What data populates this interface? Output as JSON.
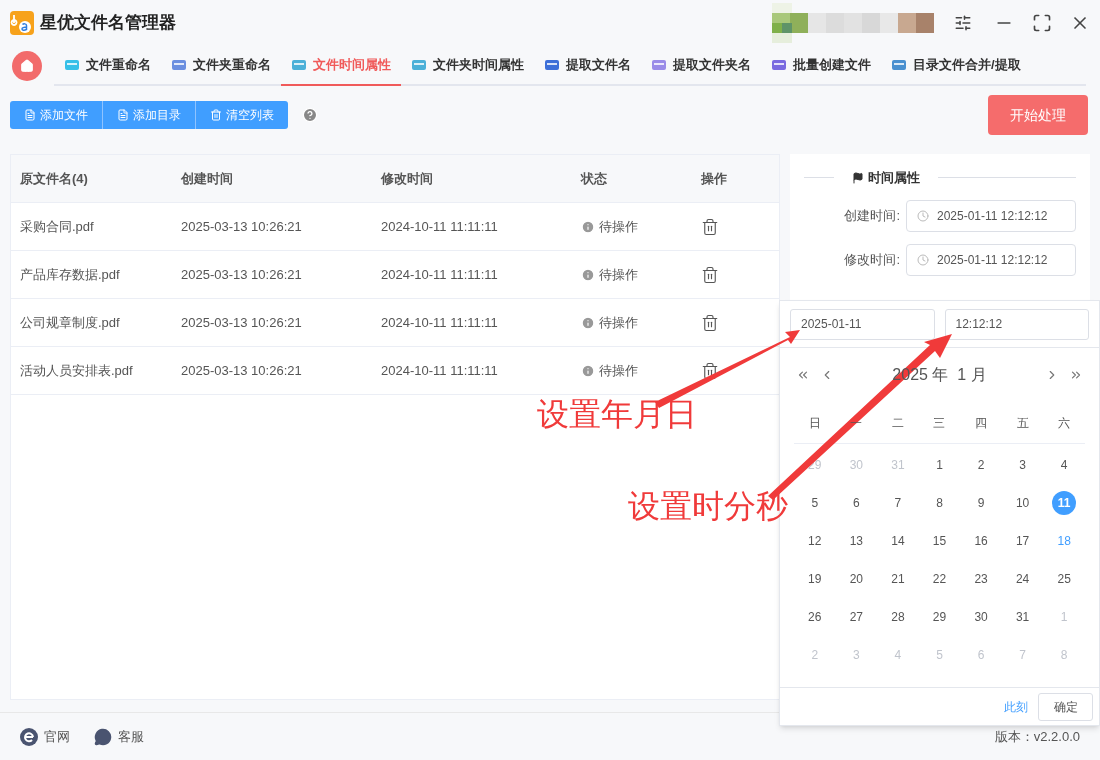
{
  "window": {
    "title": "星优文件名管理器"
  },
  "tabs": [
    {
      "label": "文件重命名",
      "selected": false,
      "color": "#36c0e8"
    },
    {
      "label": "文件夹重命名",
      "selected": false,
      "color": "#6b8fe0"
    },
    {
      "label": "文件时间属性",
      "selected": true,
      "color": "#4bb0d8"
    },
    {
      "label": "文件夹时间属性",
      "selected": false,
      "color": "#4bb0d8"
    },
    {
      "label": "提取文件名",
      "selected": false,
      "color": "#3d6fd8"
    },
    {
      "label": "提取文件夹名",
      "selected": false,
      "color": "#9a8ce8"
    },
    {
      "label": "批量创建文件",
      "selected": false,
      "color": "#7a6ae0"
    },
    {
      "label": "目录文件合并/提取",
      "selected": false,
      "color": "#4a90d0"
    }
  ],
  "toolbar": {
    "buttons": [
      {
        "label": "添加文件",
        "kind": "file"
      },
      {
        "label": "添加目录",
        "kind": "file"
      },
      {
        "label": "清空列表",
        "kind": "trash"
      }
    ],
    "start_button": "开始处理"
  },
  "table": {
    "columns": [
      "原文件名(4)",
      "创建时间",
      "修改时间",
      "状态",
      "操作"
    ],
    "rows": [
      {
        "name": "采购合同.pdf",
        "created": "2025-03-13 10:26:21",
        "modified": "2024-10-11 11:11:11",
        "status": "待操作"
      },
      {
        "name": "产品库存数据.pdf",
        "created": "2025-03-13 10:26:21",
        "modified": "2024-10-11 11:11:11",
        "status": "待操作"
      },
      {
        "name": "公司规章制度.pdf",
        "created": "2025-03-13 10:26:21",
        "modified": "2024-10-11 11:11:11",
        "status": "待操作"
      },
      {
        "name": "活动人员安排表.pdf",
        "created": "2025-03-13 10:26:21",
        "modified": "2024-10-11 11:11:11",
        "status": "待操作"
      }
    ]
  },
  "panel": {
    "title": "时间属性",
    "fields": [
      {
        "label": "创建时间:",
        "value": "2025-01-11 12:12:12"
      },
      {
        "label": "修改时间:",
        "value": "2025-01-11 12:12:12"
      }
    ]
  },
  "date_picker": {
    "date_value": "2025-01-11",
    "time_value": "12:12:12",
    "month_label": "2025 年  1 月",
    "weekdays": [
      "日",
      "一",
      "二",
      "三",
      "四",
      "五",
      "六"
    ],
    "days": [
      {
        "label": "29",
        "outside": true,
        "selected": false,
        "today": false
      },
      {
        "label": "30",
        "outside": true,
        "selected": false,
        "today": false
      },
      {
        "label": "31",
        "outside": true,
        "selected": false,
        "today": false
      },
      {
        "label": "1",
        "outside": false,
        "selected": false,
        "today": false
      },
      {
        "label": "2",
        "outside": false,
        "selected": false,
        "today": false
      },
      {
        "label": "3",
        "outside": false,
        "selected": false,
        "today": false
      },
      {
        "label": "4",
        "outside": false,
        "selected": false,
        "today": false
      },
      {
        "label": "5",
        "outside": false,
        "selected": false,
        "today": false
      },
      {
        "label": "6",
        "outside": false,
        "selected": false,
        "today": false
      },
      {
        "label": "7",
        "outside": false,
        "selected": false,
        "today": false
      },
      {
        "label": "8",
        "outside": false,
        "selected": false,
        "today": false
      },
      {
        "label": "9",
        "outside": false,
        "selected": false,
        "today": false
      },
      {
        "label": "10",
        "outside": false,
        "selected": false,
        "today": false
      },
      {
        "label": "11",
        "outside": false,
        "selected": true,
        "today": false
      },
      {
        "label": "12",
        "outside": false,
        "selected": false,
        "today": false
      },
      {
        "label": "13",
        "outside": false,
        "selected": false,
        "today": false
      },
      {
        "label": "14",
        "outside": false,
        "selected": false,
        "today": false
      },
      {
        "label": "15",
        "outside": false,
        "selected": false,
        "today": false
      },
      {
        "label": "16",
        "outside": false,
        "selected": false,
        "today": false
      },
      {
        "label": "17",
        "outside": false,
        "selected": false,
        "today": false
      },
      {
        "label": "18",
        "outside": false,
        "selected": false,
        "today": true
      },
      {
        "label": "19",
        "outside": false,
        "selected": false,
        "today": false
      },
      {
        "label": "20",
        "outside": false,
        "selected": false,
        "today": false
      },
      {
        "label": "21",
        "outside": false,
        "selected": false,
        "today": false
      },
      {
        "label": "22",
        "outside": false,
        "selected": false,
        "today": false
      },
      {
        "label": "23",
        "outside": false,
        "selected": false,
        "today": false
      },
      {
        "label": "24",
        "outside": false,
        "selected": false,
        "today": false
      },
      {
        "label": "25",
        "outside": false,
        "selected": false,
        "today": false
      },
      {
        "label": "26",
        "outside": false,
        "selected": false,
        "today": false
      },
      {
        "label": "27",
        "outside": false,
        "selected": false,
        "today": false
      },
      {
        "label": "28",
        "outside": false,
        "selected": false,
        "today": false
      },
      {
        "label": "29",
        "outside": false,
        "selected": false,
        "today": false
      },
      {
        "label": "30",
        "outside": false,
        "selected": false,
        "today": false
      },
      {
        "label": "31",
        "outside": false,
        "selected": false,
        "today": false
      },
      {
        "label": "1",
        "outside": true,
        "selected": false,
        "today": false
      },
      {
        "label": "2",
        "outside": true,
        "selected": false,
        "today": false
      },
      {
        "label": "3",
        "outside": true,
        "selected": false,
        "today": false
      },
      {
        "label": "4",
        "outside": true,
        "selected": false,
        "today": false
      },
      {
        "label": "5",
        "outside": true,
        "selected": false,
        "today": false
      },
      {
        "label": "6",
        "outside": true,
        "selected": false,
        "today": false
      },
      {
        "label": "7",
        "outside": true,
        "selected": false,
        "today": false
      },
      {
        "label": "8",
        "outside": true,
        "selected": false,
        "today": false
      }
    ],
    "now_link": "此刻",
    "ok_button": "确定"
  },
  "annotations": [
    "设置年月日",
    "设置时分秒"
  ],
  "footer": {
    "links": [
      {
        "label": "官网",
        "kind": "web"
      },
      {
        "label": "客服",
        "kind": "chat"
      }
    ],
    "version": "版本：v2.2.0.0"
  }
}
